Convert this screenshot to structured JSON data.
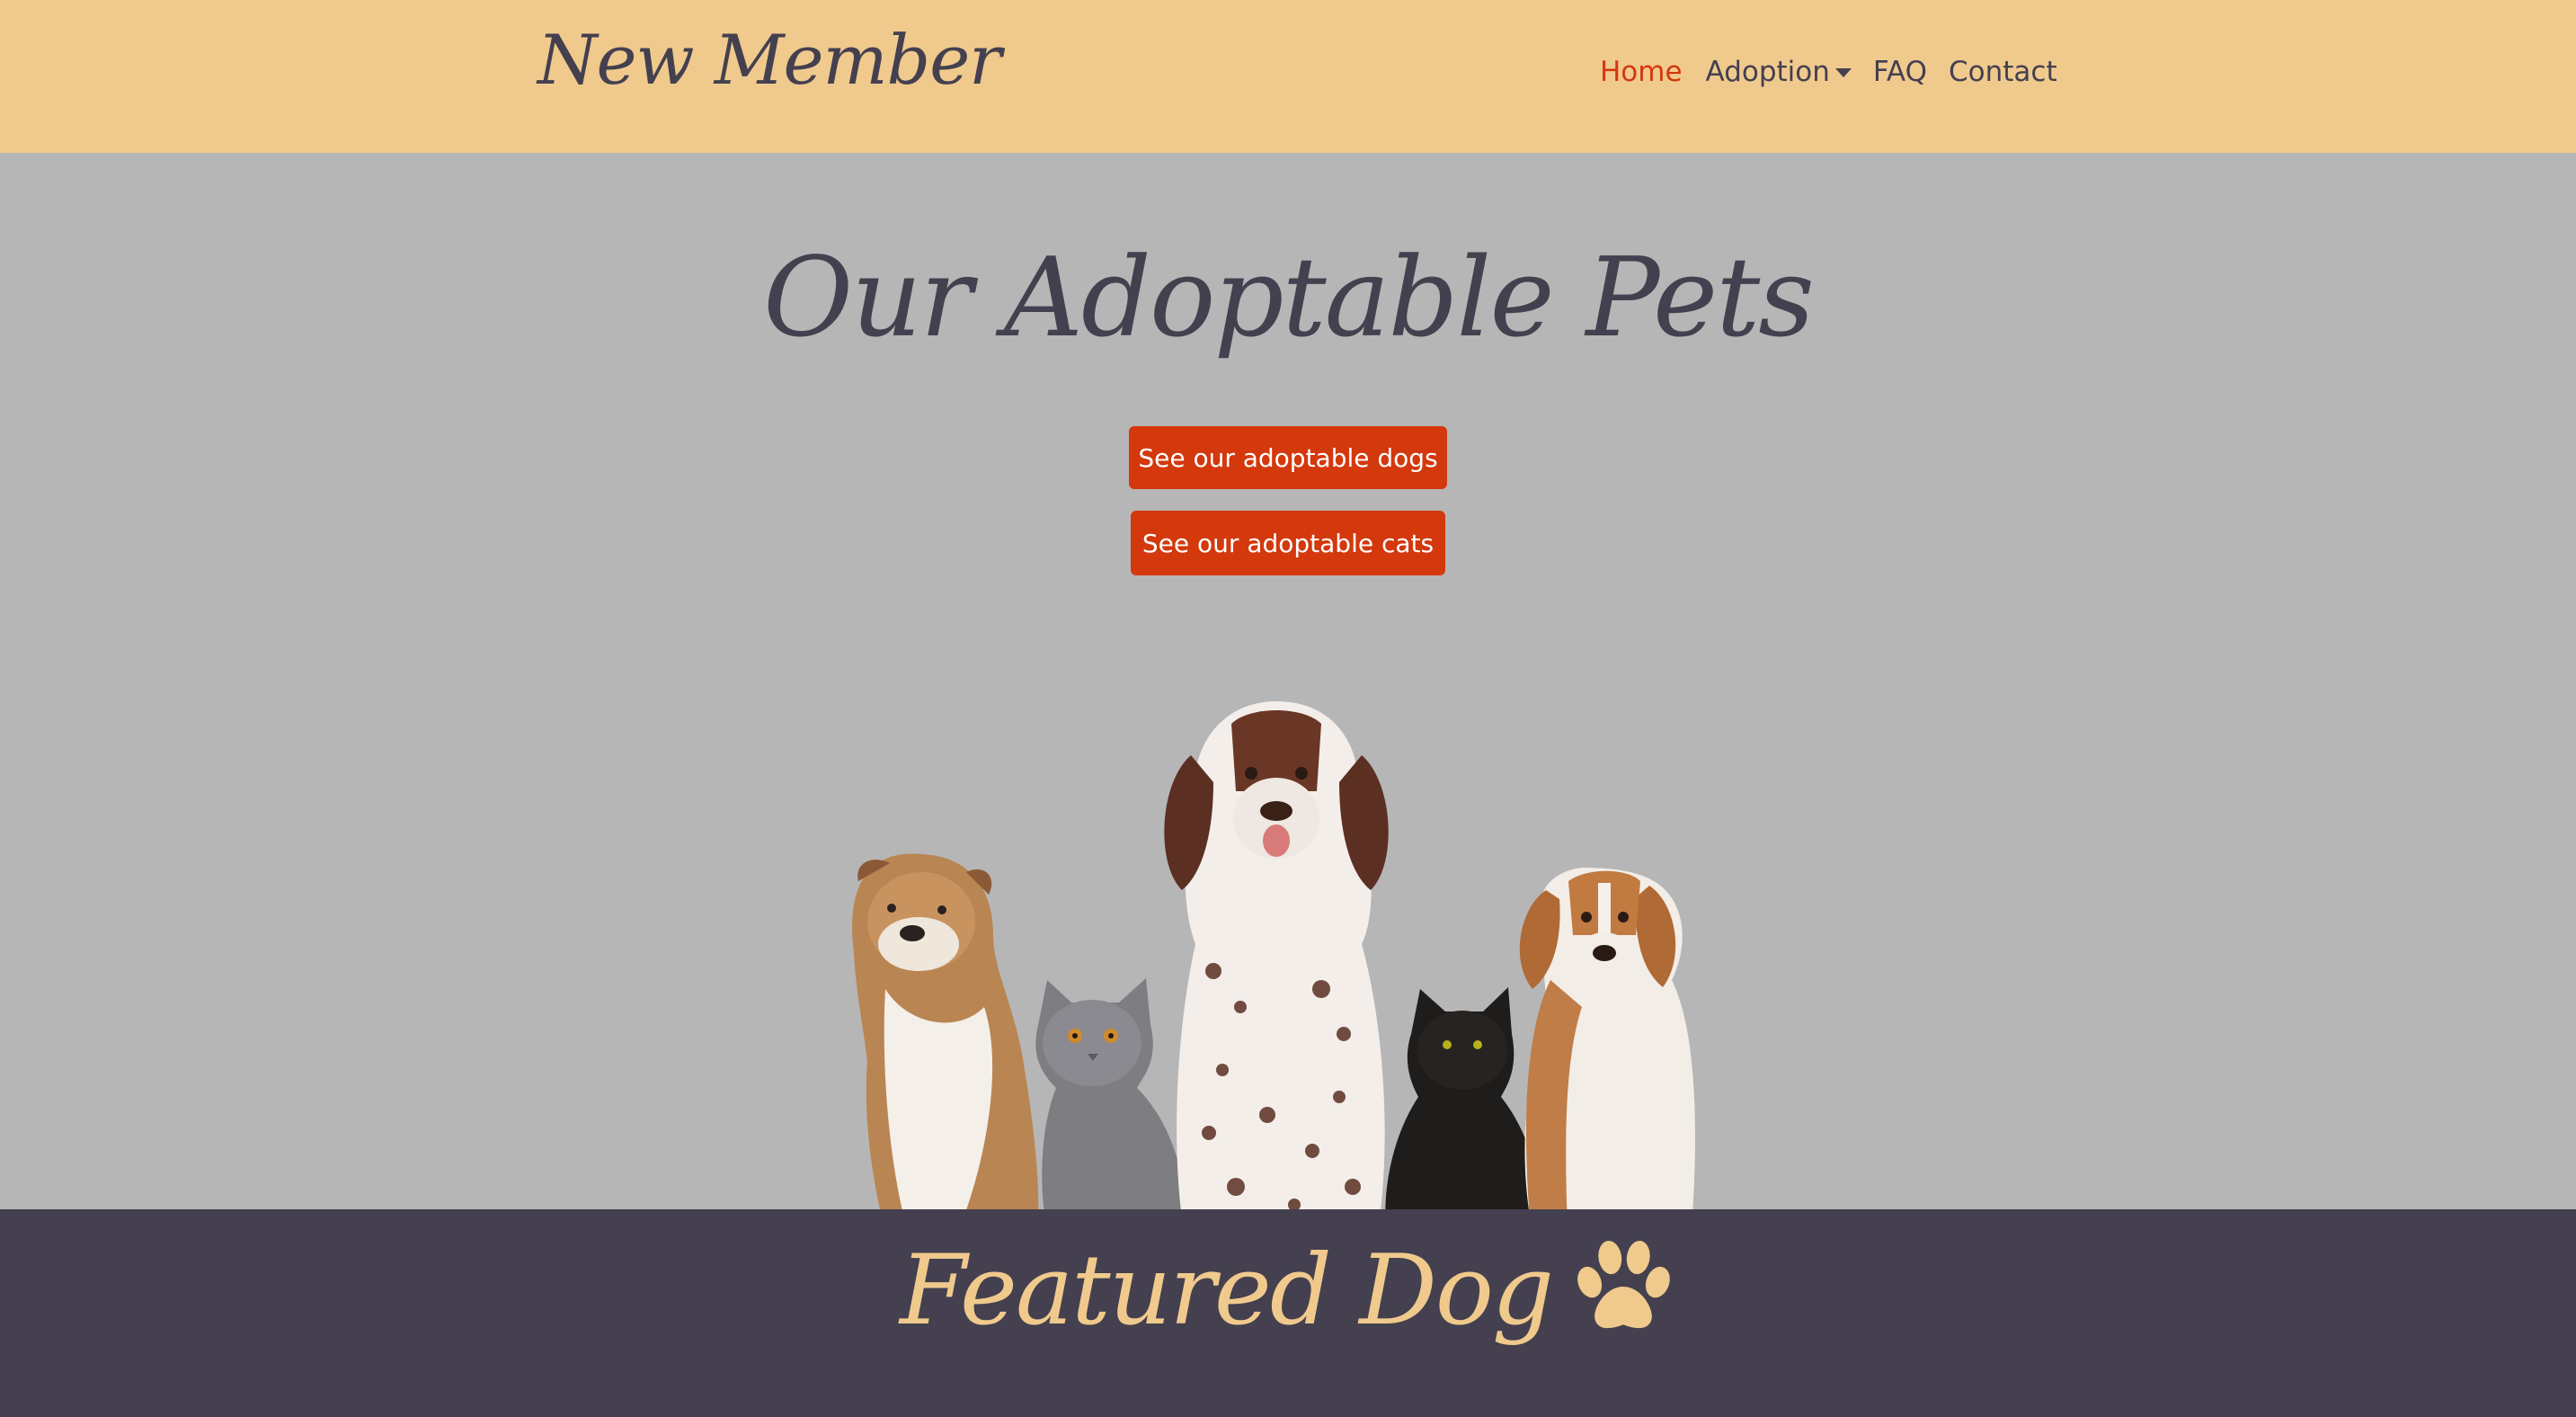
{
  "brand": "New Member",
  "nav": {
    "home": "Home",
    "adoption": "Adoption",
    "faq": "FAQ",
    "contact": "Contact"
  },
  "hero": {
    "title": "Our Adoptable Pets",
    "dogs_button": "See our adoptable dogs",
    "cats_button": "See our adoptable cats",
    "photo_icon": "group-of-dogs-and-cats-photo"
  },
  "featured": {
    "title": "Featured Dog",
    "icon": "paw-icon"
  },
  "colors": {
    "navbar_bg": "#f0ca8d",
    "hero_bg": "#b6b6b6",
    "text_dark": "#44404f",
    "accent": "#d4380d",
    "footer_bg": "#44404f"
  }
}
